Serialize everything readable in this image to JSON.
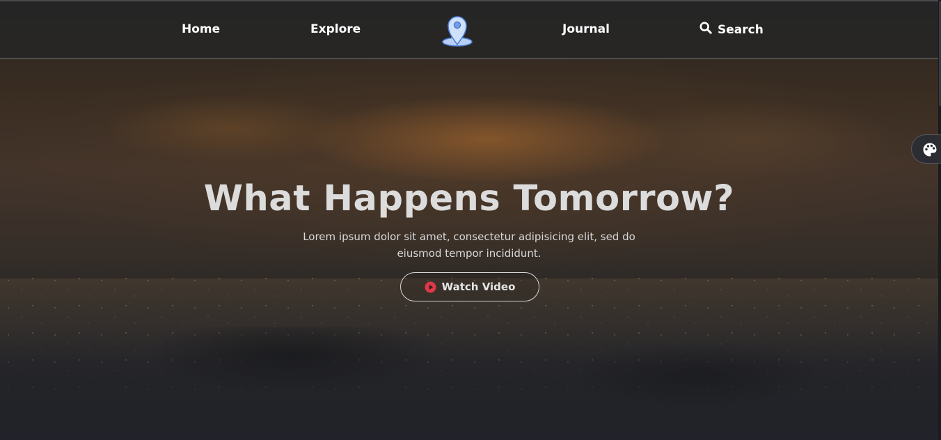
{
  "nav": {
    "items": [
      {
        "label": "Home"
      },
      {
        "label": "Explore"
      },
      {
        "label": "Journal"
      },
      {
        "label": "Search"
      }
    ],
    "logo_icon": "map-pin-icon",
    "search_icon": "search-icon"
  },
  "hero": {
    "title": "What Happens Tomorrow?",
    "subtitle": "Lorem ipsum dolor sit amet, consectetur adipisicing elit, sed do eiusmod tempor incididunt.",
    "cta_label": "Watch Video",
    "cta_icon": "play-icon"
  },
  "theme_switcher": {
    "icon": "palette-icon"
  },
  "colors": {
    "accent": "#e0384a",
    "logo_blue": "#5b8fe0",
    "text": "#ffffff"
  }
}
